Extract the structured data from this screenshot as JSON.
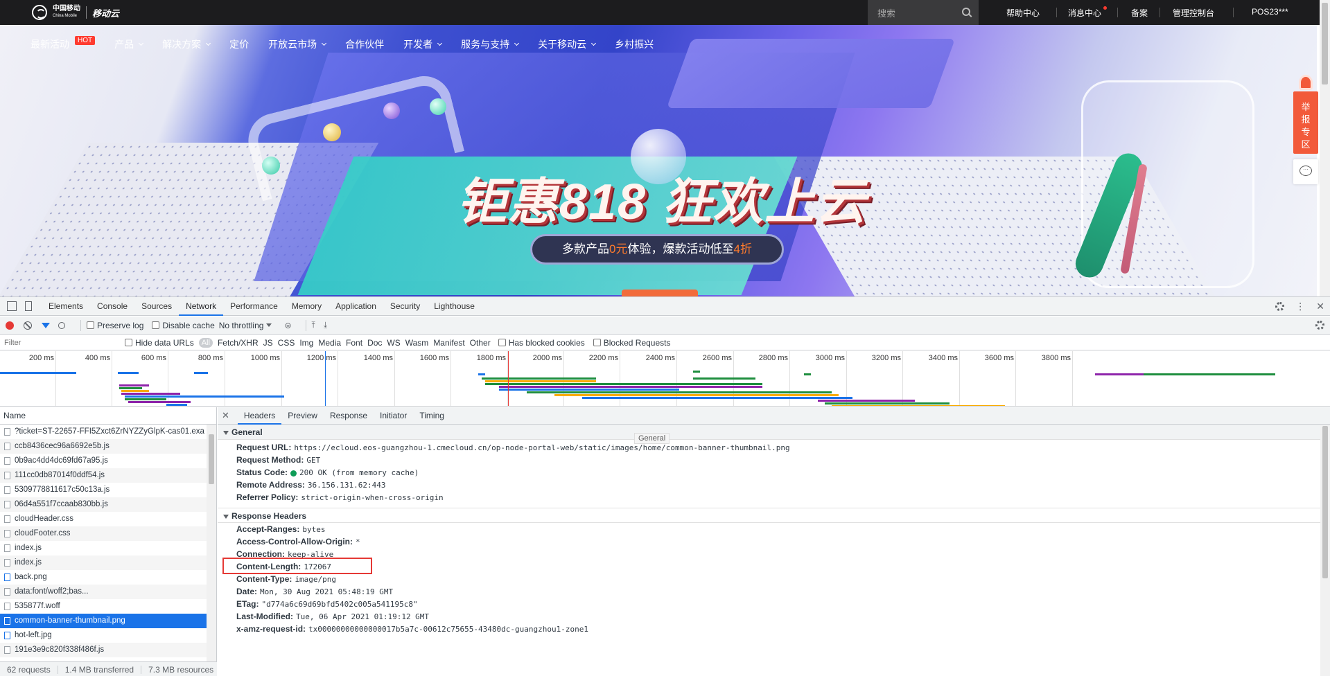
{
  "site": {
    "logo_cm": "中国移动",
    "logo_cm_en": "China Mobile",
    "logo_cloud": "移动云",
    "search_placeholder": "搜索",
    "top_links": [
      "帮助中心",
      "消息中心",
      "备案",
      "管理控制台",
      "POS23***"
    ],
    "nav": [
      {
        "label": "最新活动",
        "badge": "HOT",
        "caret": false
      },
      {
        "label": "产品",
        "caret": true
      },
      {
        "label": "解决方案",
        "caret": true
      },
      {
        "label": "定价",
        "caret": false
      },
      {
        "label": "开放云市场",
        "caret": true
      },
      {
        "label": "合作伙伴",
        "caret": false
      },
      {
        "label": "开发者",
        "caret": true
      },
      {
        "label": "服务与支持",
        "caret": true
      },
      {
        "label": "关于移动云",
        "caret": true
      },
      {
        "label": "乡村振兴",
        "caret": false
      }
    ],
    "hero": {
      "slogan": "钜惠818 狂欢上云",
      "sub_pre": "多款产品",
      "sub_hl1": "0元",
      "sub_mid": "体验，爆款活动低至",
      "sub_hl2": "4折"
    },
    "side_report": "举报专区"
  },
  "devtools": {
    "tabs": [
      "Elements",
      "Console",
      "Sources",
      "Network",
      "Performance",
      "Memory",
      "Application",
      "Security",
      "Lighthouse"
    ],
    "active_tab": "Network",
    "toolbar": {
      "preserve_log": "Preserve log",
      "disable_cache": "Disable cache",
      "throttling": "No throttling"
    },
    "filter": {
      "placeholder": "Filter",
      "hide_data_urls": "Hide data URLs",
      "types": [
        "All",
        "Fetch/XHR",
        "JS",
        "CSS",
        "Img",
        "Media",
        "Font",
        "Doc",
        "WS",
        "Wasm",
        "Manifest",
        "Other"
      ],
      "has_blocked_cookies": "Has blocked cookies",
      "blocked_requests": "Blocked Requests"
    },
    "timeline_ticks": [
      "200 ms",
      "400 ms",
      "600 ms",
      "800 ms",
      "1000 ms",
      "1200 ms",
      "1400 ms",
      "1600 ms",
      "1800 ms",
      "2000 ms",
      "2200 ms",
      "2400 ms",
      "2600 ms",
      "2800 ms",
      "3000 ms",
      "3200 ms",
      "3400 ms",
      "3600 ms",
      "3800 ms"
    ],
    "list_header": "Name",
    "requests": [
      {
        "name": "?ticket=ST-22657-FFI5Zxct6ZrNYZZyGlpK-cas01.exa",
        "type": "doc"
      },
      {
        "name": "ccb8436cec96a6692e5b.js",
        "type": "js"
      },
      {
        "name": "0b9ac4dd4dc69fd67a95.js",
        "type": "js"
      },
      {
        "name": "111cc0db87014f0ddf54.js",
        "type": "js"
      },
      {
        "name": "5309778811617c50c13a.js",
        "type": "js"
      },
      {
        "name": "06d4a551f7ccaab830bb.js",
        "type": "js"
      },
      {
        "name": "cloudHeader.css",
        "type": "css"
      },
      {
        "name": "cloudFooter.css",
        "type": "css"
      },
      {
        "name": "index.js",
        "type": "js"
      },
      {
        "name": "index.js",
        "type": "js"
      },
      {
        "name": "back.png",
        "type": "img"
      },
      {
        "name": "data:font/woff2;bas...",
        "type": "font"
      },
      {
        "name": "535877f.woff",
        "type": "font"
      },
      {
        "name": "common-banner-thumbnail.png",
        "type": "img",
        "selected": true
      },
      {
        "name": "hot-left.jpg",
        "type": "img"
      },
      {
        "name": "191e3e9c820f338f486f.js",
        "type": "js"
      }
    ],
    "status": {
      "requests": "62 requests",
      "transferred": "1.4 MB transferred",
      "resources": "7.3 MB resources"
    },
    "detail_tabs": [
      "Headers",
      "Preview",
      "Response",
      "Initiator",
      "Timing"
    ],
    "active_detail_tab": "Headers",
    "tooltip": "General",
    "general_title": "General",
    "general": [
      {
        "k": "Request URL:",
        "v": "https://ecloud.eos-guangzhou-1.cmecloud.cn/op-node-portal-web/static/images/home/common-banner-thumbnail.png"
      },
      {
        "k": "Request Method:",
        "v": "GET"
      },
      {
        "k": "Status Code:",
        "v": "200 OK (from memory cache)",
        "dot": true
      },
      {
        "k": "Remote Address:",
        "v": "36.156.131.62:443"
      },
      {
        "k": "Referrer Policy:",
        "v": "strict-origin-when-cross-origin"
      }
    ],
    "response_title": "Response Headers",
    "response_headers": [
      {
        "k": "Accept-Ranges:",
        "v": "bytes"
      },
      {
        "k": "Access-Control-Allow-Origin:",
        "v": "*"
      },
      {
        "k": "Connection:",
        "v": "keep-alive"
      },
      {
        "k": "Content-Length:",
        "v": "172067",
        "highlight": true
      },
      {
        "k": "Content-Type:",
        "v": "image/png"
      },
      {
        "k": "Date:",
        "v": "Mon, 30 Aug 2021 05:48:19 GMT"
      },
      {
        "k": "ETag:",
        "v": "\"d774a6c69d69bfd5402c005a541195c8\""
      },
      {
        "k": "Last-Modified:",
        "v": "Tue, 06 Apr 2021 01:19:12 GMT"
      },
      {
        "k": "x-amz-request-id:",
        "v": "tx00000000000000017b5a7c-00612c75655-43480dc-guangzhou1-zone1"
      }
    ]
  }
}
